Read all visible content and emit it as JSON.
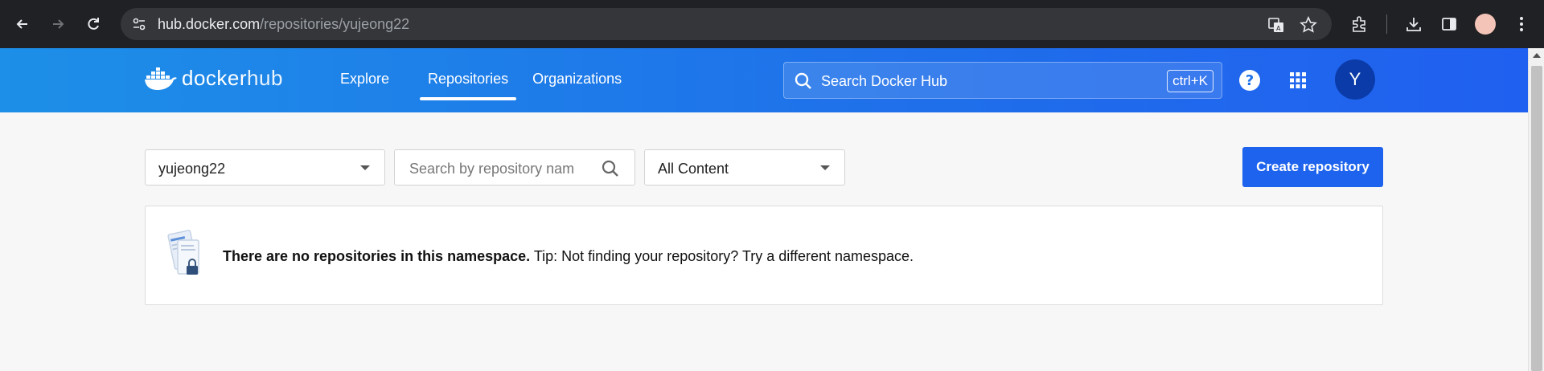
{
  "browser": {
    "url_host": "hub.docker.com",
    "url_path": "/repositories/yujeong22"
  },
  "header": {
    "logo_text": "docker",
    "logo_suffix": "hub",
    "nav": [
      {
        "label": "Explore",
        "active": false
      },
      {
        "label": "Repositories",
        "active": true
      },
      {
        "label": "Organizations",
        "active": false
      }
    ],
    "search_placeholder": "Search Docker Hub",
    "search_shortcut": "ctrl+K",
    "avatar_initial": "Y"
  },
  "controls": {
    "namespace_value": "yujeong22",
    "repo_search_placeholder": "Search by repository name",
    "content_filter_value": "All Content",
    "create_button_label": "Create repository"
  },
  "empty_state": {
    "title": "There are no repositories in this namespace.",
    "tip": " Tip: Not finding your repository? Try a different namespace."
  },
  "colors": {
    "header_blue": "#1d8fe8",
    "button_blue": "#1d63ed",
    "avatar_bg": "#0b3ba8"
  }
}
